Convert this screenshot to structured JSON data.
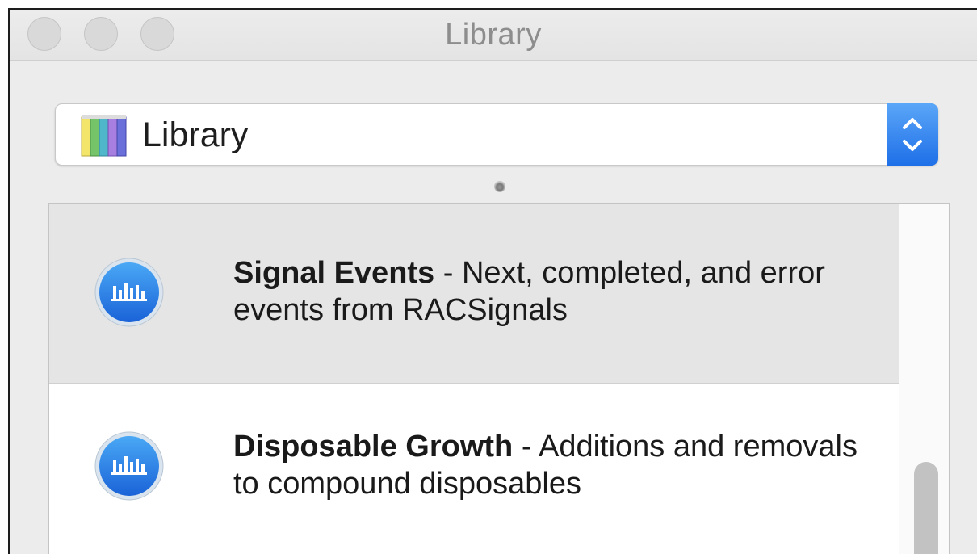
{
  "window": {
    "title": "Library"
  },
  "library_popup": {
    "selected": "Library",
    "icon": "library-books-icon"
  },
  "instruments": [
    {
      "name": "Signal Events",
      "separator": " - ",
      "description": "Next, completed, and error events from RACSignals",
      "icon": "instrument-bars-icon",
      "selected": true
    },
    {
      "name": "Disposable Growth",
      "separator": " - ",
      "description": "Additions and removals to compound disposables",
      "icon": "instrument-bars-icon",
      "selected": false
    }
  ],
  "colors": {
    "accent_blue": "#1f6fe8",
    "selected_row": "#e5e5e5"
  }
}
